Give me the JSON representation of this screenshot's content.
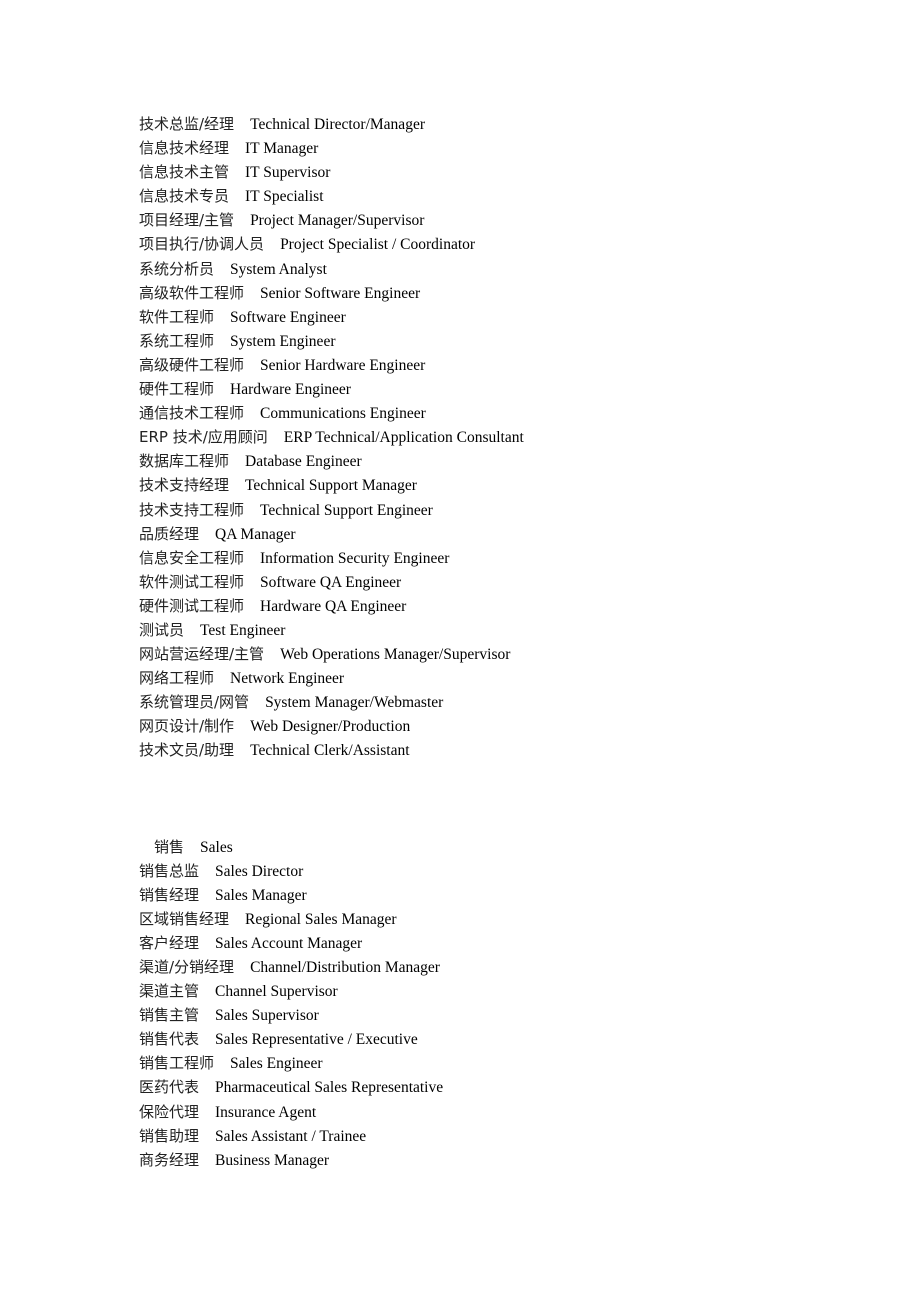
{
  "sections": [
    {
      "heading": null,
      "items": [
        {
          "zh": "技术总监/经理",
          "en": "Technical Director/Manager"
        },
        {
          "zh": "信息技术经理",
          "en": "IT Manager"
        },
        {
          "zh": "信息技术主管",
          "en": "IT Supervisor"
        },
        {
          "zh": "信息技术专员",
          "en": "IT Specialist"
        },
        {
          "zh": "项目经理/主管",
          "en": "Project Manager/Supervisor"
        },
        {
          "zh": "项目执行/协调人员",
          "en": "Project Specialist / Coordinator"
        },
        {
          "zh": "系统分析员",
          "en": "System Analyst"
        },
        {
          "zh": "高级软件工程师",
          "en": "Senior Software Engineer"
        },
        {
          "zh": "软件工程师",
          "en": "Software Engineer"
        },
        {
          "zh": "系统工程师",
          "en": "System Engineer"
        },
        {
          "zh": "高级硬件工程师",
          "en": "Senior Hardware Engineer"
        },
        {
          "zh": "硬件工程师",
          "en": "Hardware Engineer"
        },
        {
          "zh": "通信技术工程师",
          "en": "Communications Engineer"
        },
        {
          "zh": "ERP 技术/应用顾问",
          "en": "ERP Technical/Application Consultant"
        },
        {
          "zh": "数据库工程师",
          "en": "Database Engineer"
        },
        {
          "zh": "技术支持经理",
          "en": "Technical Support Manager"
        },
        {
          "zh": "技术支持工程师",
          "en": "Technical Support Engineer"
        },
        {
          "zh": "品质经理",
          "en": "QA Manager"
        },
        {
          "zh": "信息安全工程师",
          "en": "Information Security Engineer"
        },
        {
          "zh": "软件测试工程师",
          "en": "Software QA Engineer"
        },
        {
          "zh": "硬件测试工程师",
          "en": "Hardware QA Engineer"
        },
        {
          "zh": "测试员",
          "en": "Test Engineer"
        },
        {
          "zh": "网站营运经理/主管",
          "en": "Web Operations Manager/Supervisor"
        },
        {
          "zh": "网络工程师",
          "en": "Network Engineer"
        },
        {
          "zh": "系统管理员/网管",
          "en": "System Manager/Webmaster"
        },
        {
          "zh": "网页设计/制作",
          "en": "Web Designer/Production"
        },
        {
          "zh": "技术文员/助理",
          "en": "Technical Clerk/Assistant"
        }
      ]
    },
    {
      "heading": {
        "zh": "销售",
        "en": "Sales"
      },
      "items": [
        {
          "zh": "销售总监",
          "en": "Sales Director"
        },
        {
          "zh": "销售经理",
          "en": "Sales Manager"
        },
        {
          "zh": "区域销售经理",
          "en": "Regional Sales Manager"
        },
        {
          "zh": "客户经理",
          "en": "Sales Account Manager"
        },
        {
          "zh": "渠道/分销经理",
          "en": "Channel/Distribution Manager"
        },
        {
          "zh": "渠道主管",
          "en": "Channel Supervisor"
        },
        {
          "zh": "销售主管",
          "en": "Sales Supervisor"
        },
        {
          "zh": "销售代表",
          "en": "Sales Representative / Executive"
        },
        {
          "zh": "销售工程师",
          "en": "Sales Engineer"
        },
        {
          "zh": "医药代表",
          "en": "Pharmaceutical Sales Representative"
        },
        {
          "zh": "保险代理",
          "en": "Insurance Agent"
        },
        {
          "zh": "销售助理",
          "en": "Sales Assistant / Trainee"
        },
        {
          "zh": "商务经理",
          "en": "Business Manager"
        }
      ]
    }
  ]
}
